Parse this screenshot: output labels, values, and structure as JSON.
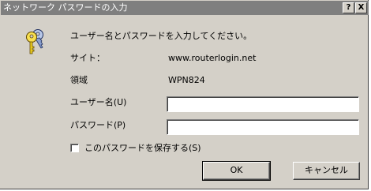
{
  "window": {
    "title": "ネットワーク パスワードの入力",
    "help_label": "?",
    "close_label": "X"
  },
  "icon": "keys-icon",
  "prompt": "ユーザー名とパスワードを入力してください。",
  "site": {
    "label": "サイト：",
    "value": "www.routerlogin.net"
  },
  "realm": {
    "label": "領域",
    "value": "WPN824"
  },
  "username": {
    "label": "ユーザー名(U)",
    "value": ""
  },
  "password": {
    "label": "パスワード(P)",
    "value": ""
  },
  "save_password": {
    "label": "このパスワードを保存する(S)",
    "checked": false
  },
  "buttons": {
    "ok": "OK",
    "cancel": "キャンセル"
  },
  "colors": {
    "titlebar_inactive": "#7f7f7f",
    "face": "#d4d0c8"
  }
}
